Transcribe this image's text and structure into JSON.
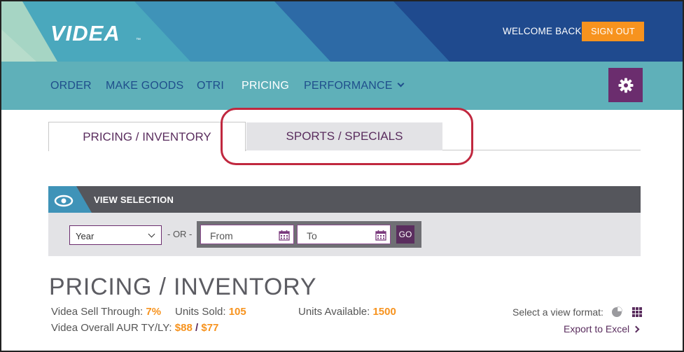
{
  "header": {
    "logo": "VIDEA",
    "logo_tm": "™",
    "welcome_text": "WELCOME BACK",
    "signout_label": "SIGN OUT",
    "colors": {
      "banner": "#1e4a8d",
      "teal": "#5fb0b9",
      "accent": "#f7931e"
    }
  },
  "nav": {
    "items": [
      {
        "label": "ORDER",
        "active": false
      },
      {
        "label": "MAKE GOODS",
        "active": false
      },
      {
        "label": "OTRI",
        "active": false
      },
      {
        "label": "PRICING",
        "active": true
      },
      {
        "label": "PERFORMANCE",
        "active": false,
        "has_dropdown": true
      }
    ],
    "settings_icon": "gear-icon"
  },
  "tabs": [
    {
      "label": "PRICING / INVENTORY",
      "active": true
    },
    {
      "label": "SPORTS / SPECIALS",
      "active": false,
      "highlighted": true
    }
  ],
  "view_selection": {
    "title": "VIEW SELECTION",
    "icon": "eye-icon",
    "period_select": {
      "value": "Year"
    },
    "or_text": "- OR -",
    "from_placeholder": "From",
    "to_placeholder": "To",
    "go_label": "GO"
  },
  "content": {
    "title": "PRICING / INVENTORY",
    "stats": {
      "sell_through_label": "Videa Sell Through:",
      "sell_through_value": "7%",
      "units_sold_label": "Units Sold:",
      "units_sold_value": "105",
      "units_available_label": "Units Available:",
      "units_available_value": "1500",
      "aur_label": "Videa Overall AUR TY/LY:",
      "aur_ty": "$88",
      "aur_sep": "/",
      "aur_ly": "$77"
    },
    "view_format_label": "Select a view format:",
    "export_label": "Export to Excel"
  }
}
